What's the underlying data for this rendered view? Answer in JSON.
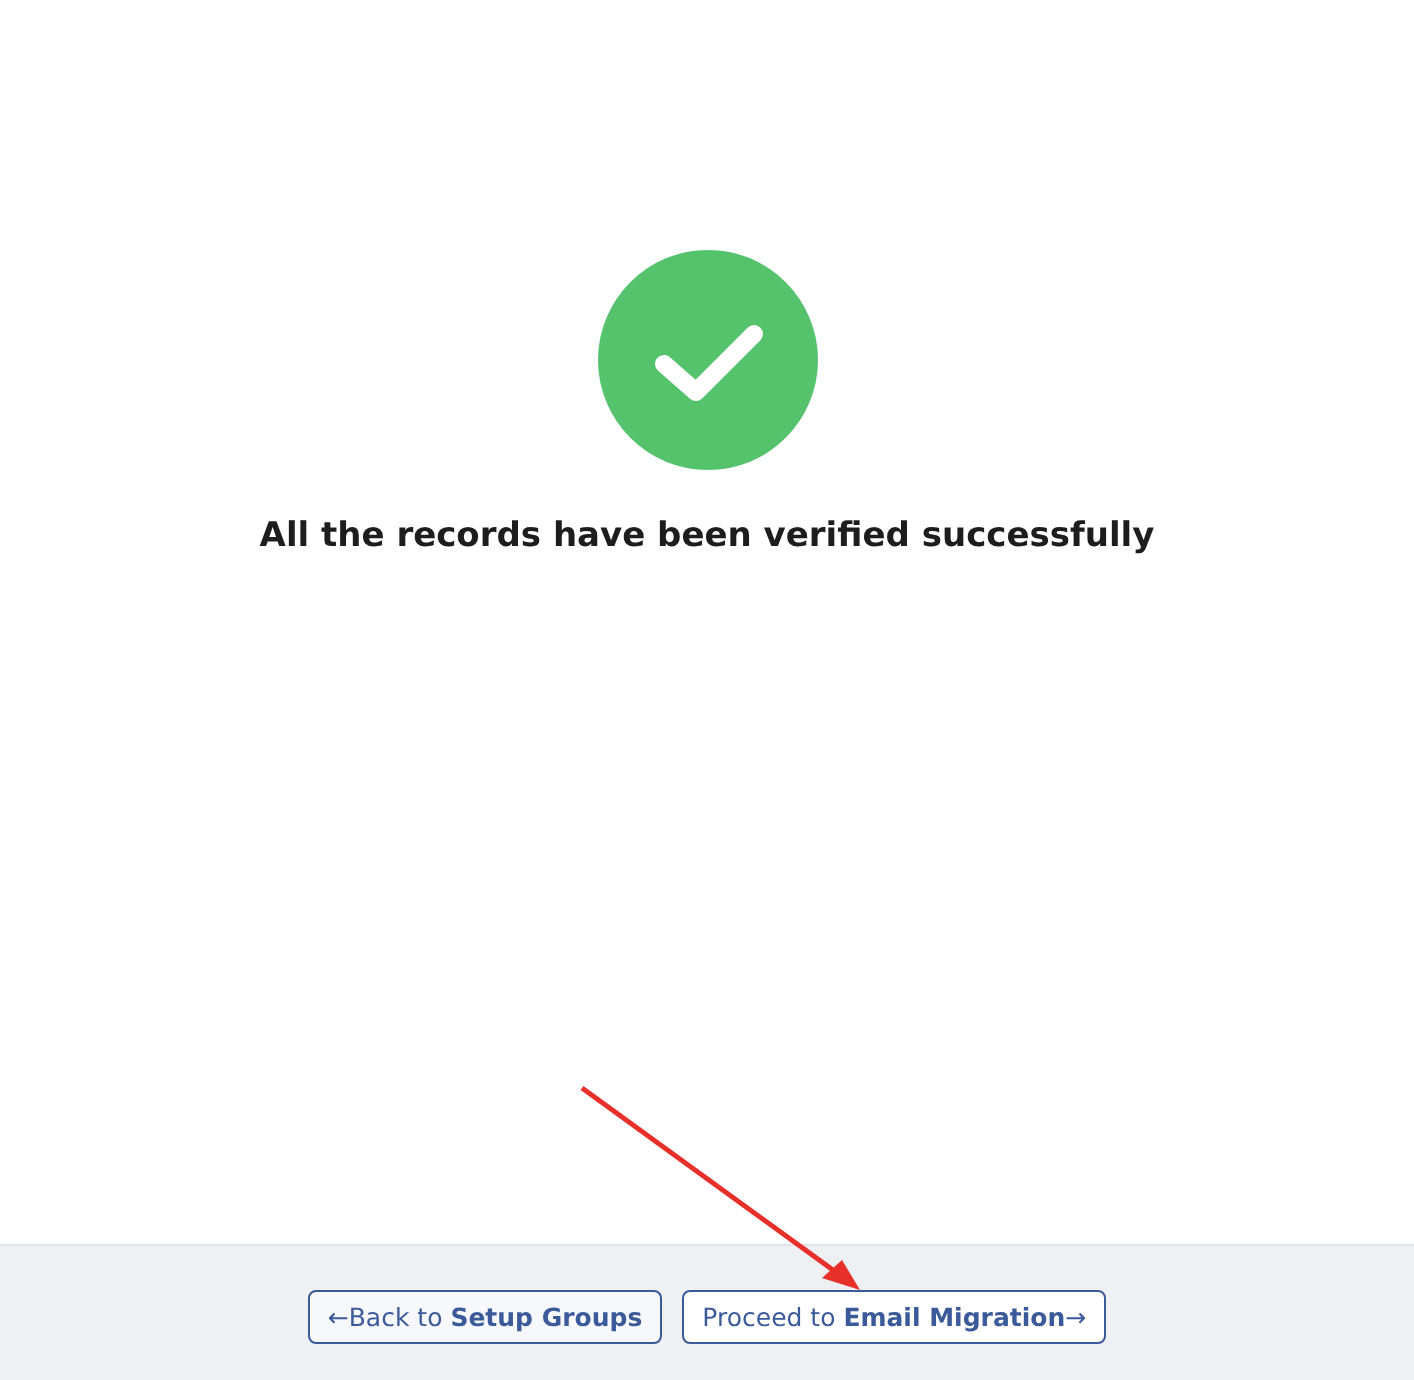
{
  "message": {
    "text": "All the records have been verified successfully"
  },
  "footer": {
    "buttons": [
      {
        "label": "←Back to **Setup Groups**",
        "kind": "back"
      },
      {
        "label": "Proceed to **Email Migration**→",
        "kind": "next"
      }
    ]
  }
}
